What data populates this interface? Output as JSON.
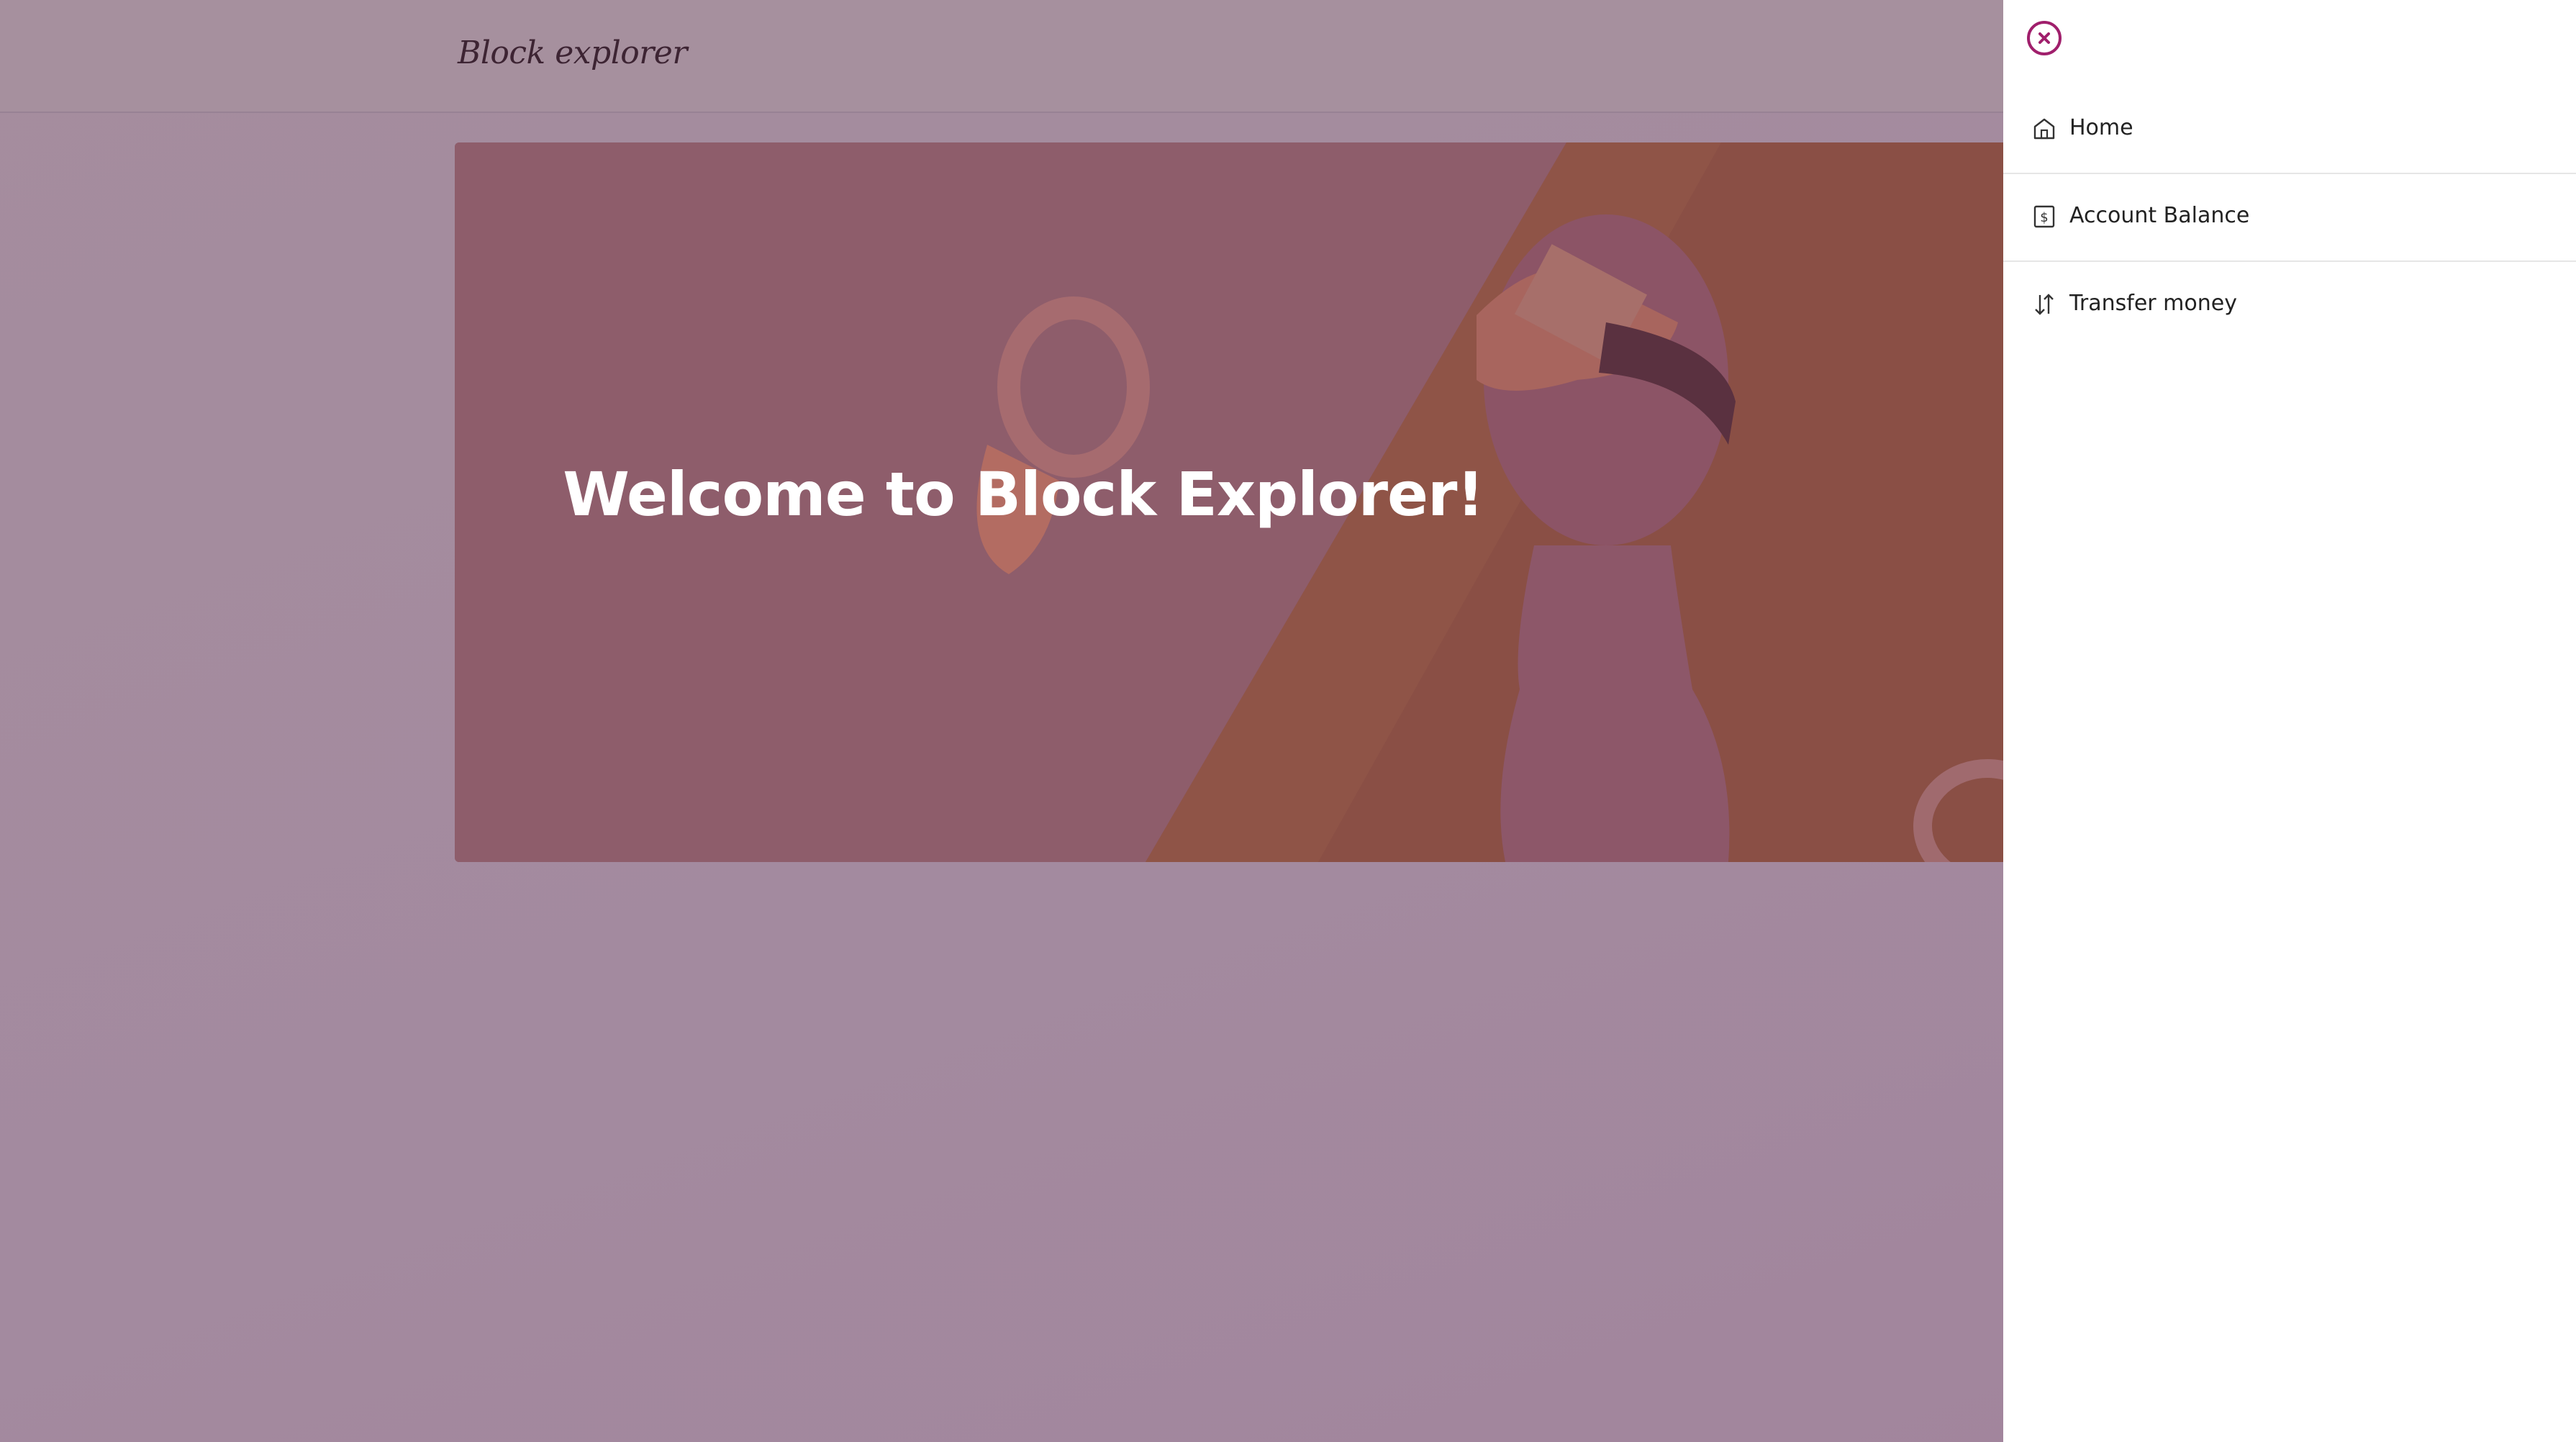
{
  "header": {
    "brand": "Block explorer"
  },
  "hero": {
    "title": "Welcome to Block Explorer!"
  },
  "drawer": {
    "close_icon": "close-icon",
    "items": [
      {
        "label": "Home",
        "icon": "home-icon"
      },
      {
        "label": "Account Balance",
        "icon": "dollar-icon"
      },
      {
        "label": "Transfer money",
        "icon": "transfer-icon"
      }
    ]
  },
  "colors": {
    "accent": "#a01f6c",
    "overlay": "#a38a9f",
    "hero_left": "#8e5d6b",
    "hero_right": "#8c5444"
  }
}
